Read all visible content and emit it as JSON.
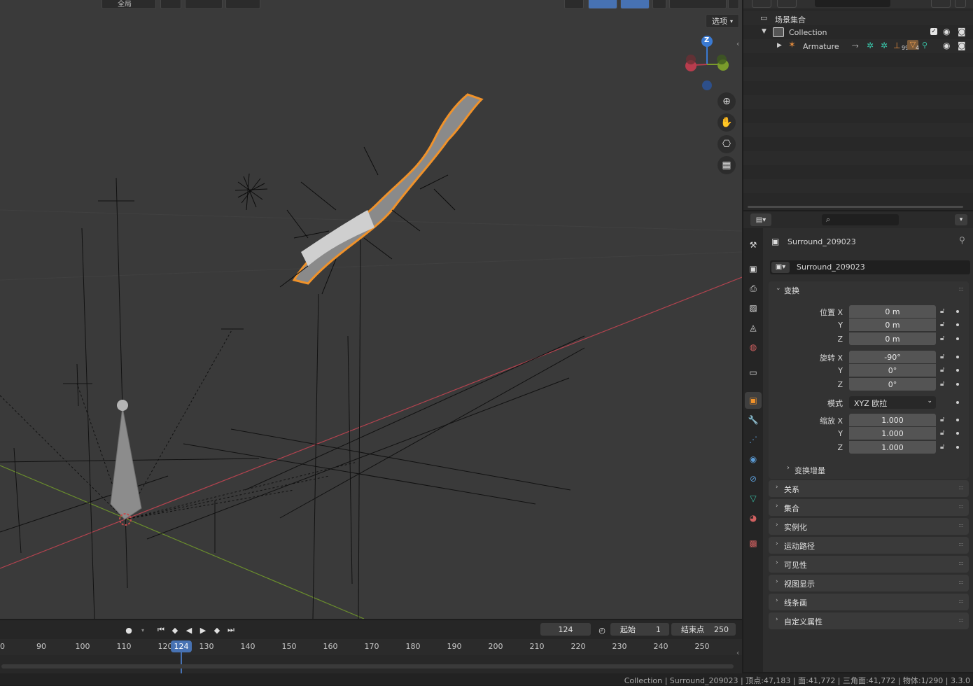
{
  "viewport": {
    "header_chip_label": "全局",
    "options_label": "选项",
    "gizmo_axis_label": "Z",
    "nav_buttons": [
      "zoom-icon",
      "hand-icon",
      "camera-icon",
      "grid-icon"
    ]
  },
  "outliner": {
    "scene_collection": "场景集合",
    "collection": "Collection",
    "armature": "Armature",
    "armature_badge_a": "99",
    "armature_badge_b": "4"
  },
  "properties": {
    "object_name": "Surround_209023",
    "datablock_name": "Surround_209023",
    "transform": {
      "title": "变换",
      "location_label": "位置 X",
      "rotation_label": "旋转 X",
      "scale_label": "缩放 X",
      "y_label": "Y",
      "z_label": "Z",
      "location": [
        "0 m",
        "0 m",
        "0 m"
      ],
      "rotation": [
        "-90°",
        "0°",
        "0°"
      ],
      "mode_label": "模式",
      "mode_value": "XYZ 欧拉",
      "scale": [
        "1.000",
        "1.000",
        "1.000"
      ],
      "delta_label": "变换增量"
    },
    "panels": [
      "关系",
      "集合",
      "实例化",
      "运动路径",
      "可见性",
      "视图显示",
      "线条画",
      "自定义属性"
    ]
  },
  "timeline": {
    "current_frame": "124",
    "start_label": "起始",
    "start_value": "1",
    "end_label": "结束点",
    "end_value": "250",
    "playhead": "124",
    "ticks": [
      "0",
      "90",
      "100",
      "110",
      "120",
      "130",
      "140",
      "150",
      "160",
      "170",
      "180",
      "190",
      "200",
      "210",
      "220",
      "230",
      "240",
      "250"
    ]
  },
  "statusbar": {
    "text": "Collection | Surround_209023 | 顶点:47,183 | 面:41,772 | 三角面:41,772 | 物体:1/290 | 3.3.0"
  },
  "colors": {
    "accent_blue": "#4772b3",
    "selection_orange": "#f0922a",
    "axis_red": "#b5434f",
    "axis_green": "#6b8f2c"
  }
}
